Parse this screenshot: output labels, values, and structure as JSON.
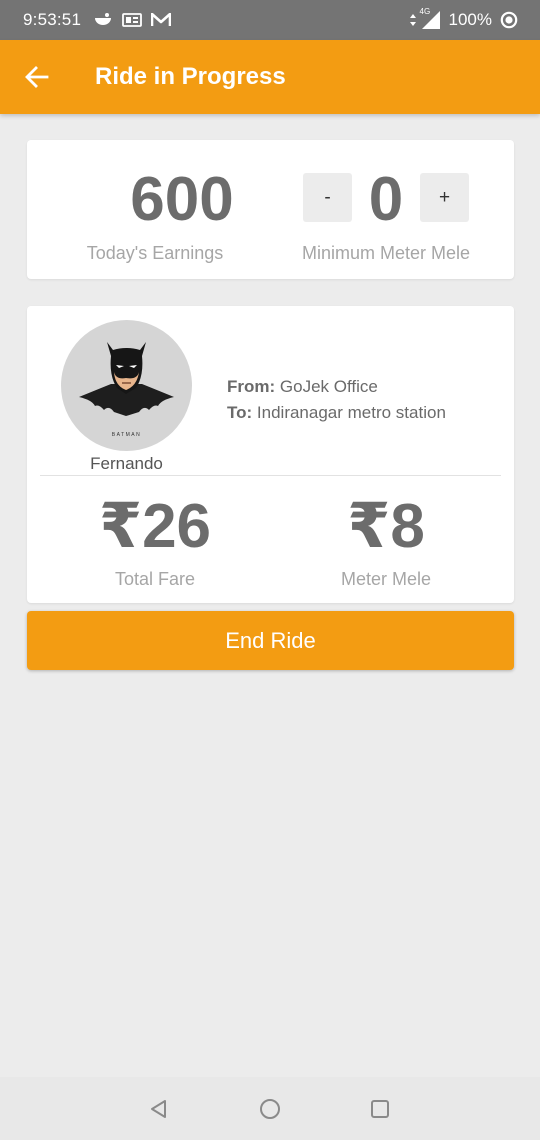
{
  "status_bar": {
    "time": "9:53:51",
    "network_label": "4G",
    "battery": "100%",
    "icons": [
      "notification-icon",
      "message-icon",
      "gmail-icon",
      "signal-icon",
      "data-saver-icon"
    ]
  },
  "app_bar": {
    "title": "Ride in Progress",
    "back_icon": "arrow-left-icon"
  },
  "earnings": {
    "value": "600",
    "label": "Today's Earnings"
  },
  "min_meter": {
    "decrement_label": "-",
    "value": "0",
    "increment_label": "+",
    "label": "Minimum Meter Mele"
  },
  "ride": {
    "rider_name": "Fernando",
    "avatar_caption": "BATMAN",
    "from_label": "From:",
    "from_value": "GoJek Office",
    "to_label": "To:",
    "to_value": "Indiranagar metro station",
    "total_fare": "₹26",
    "total_fare_label": "Total Fare",
    "meter_mele": "₹8",
    "meter_mele_label": "Meter Mele"
  },
  "actions": {
    "end_ride_label": "End Ride"
  },
  "colors": {
    "accent": "#f39c12",
    "status_bar": "#747474",
    "background": "#ececec",
    "value_text": "#6c6c6c",
    "label_text": "#a6a6a6"
  },
  "nav_bar": {
    "icons": [
      "back-triangle-icon",
      "home-circle-icon",
      "recents-square-icon"
    ]
  }
}
